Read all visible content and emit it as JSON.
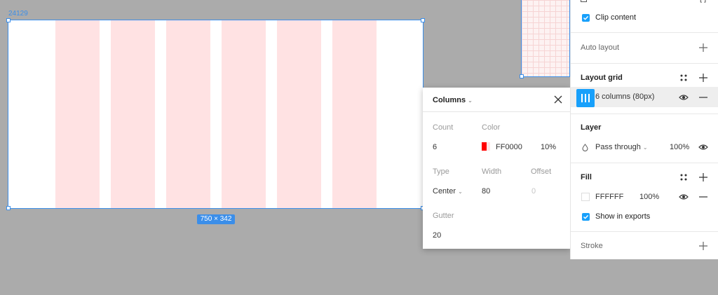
{
  "canvas": {
    "frame_name": "24129",
    "frame_size": "750 × 342",
    "column_color": "#ffe2e3",
    "selection_color": "#3b8ee9"
  },
  "columns_popup": {
    "title": "Columns",
    "count_label": "Count",
    "count_value": "6",
    "color_label": "Color",
    "color_hex": "FF0000",
    "color_opacity": "10%",
    "type_label": "Type",
    "type_value": "Center",
    "width_label": "Width",
    "width_value": "80",
    "offset_label": "Offset",
    "offset_value": "0",
    "gutter_label": "Gutter",
    "gutter_value": "20"
  },
  "panel": {
    "clip_content": "Clip content",
    "auto_layout": "Auto layout",
    "layout_grid": "Layout grid",
    "grid_item": "6 columns (80px)",
    "layer": "Layer",
    "blend_mode": "Pass through",
    "layer_opacity": "100%",
    "fill": "Fill",
    "fill_hex": "FFFFFF",
    "fill_opacity": "100%",
    "show_in_exports": "Show in exports",
    "stroke": "Stroke"
  }
}
